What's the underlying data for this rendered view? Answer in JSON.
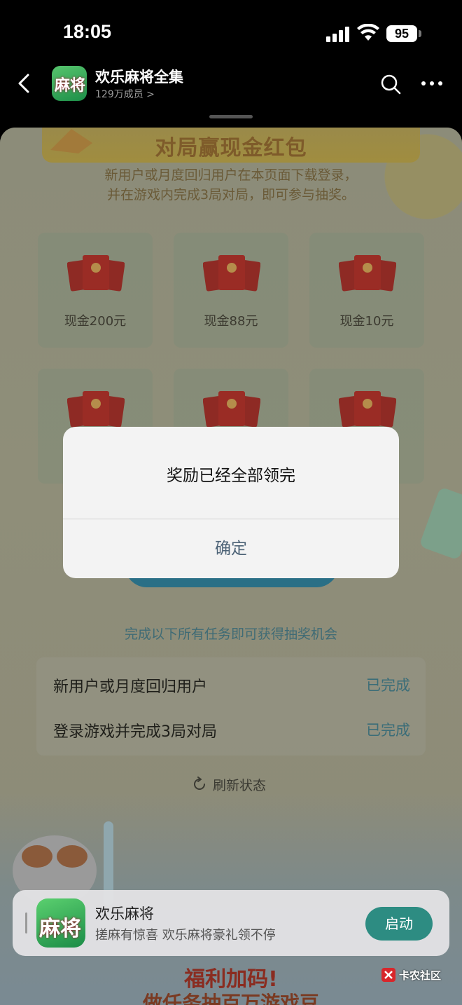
{
  "status_bar": {
    "time": "18:05",
    "battery": "95"
  },
  "header": {
    "group_name": "欢乐麻将全集",
    "member_count": "129万成员 >",
    "avatar_text": "麻将"
  },
  "banner": {
    "title": "对局赢现金红包",
    "intro_line1": "新用户或月度回归用户在本页面下载登录，",
    "intro_line2": "并在游戏内完成3局对局，即可参与抽奖。"
  },
  "rewards": [
    {
      "label": "现金200元"
    },
    {
      "label": "现金88元"
    },
    {
      "label": "现金10元"
    }
  ],
  "tasks": {
    "hint": "完成以下所有任务即可获得抽奖机会",
    "items": [
      {
        "label": "新用户或月度回归用户",
        "status": "已完成"
      },
      {
        "label": "登录游戏并完成3局对局",
        "status": "已完成"
      }
    ],
    "refresh_label": "刷新状态"
  },
  "bottom_banner": {
    "title": "福利加码!",
    "subtitle": "做任务抽百万游戏豆"
  },
  "app_card": {
    "icon_text": "麻将",
    "name": "欢乐麻将",
    "slogan": "搓麻有惊喜 欢乐麻将豪礼领不停",
    "button": "启动"
  },
  "watermark": {
    "text": "卡农社区"
  },
  "alert": {
    "message": "奖励已经全部领完",
    "confirm": "确定"
  },
  "colors": {
    "accent_teal": "#2d8c82",
    "alert_button": "#4d6377",
    "task_status": "#3b6d78"
  }
}
